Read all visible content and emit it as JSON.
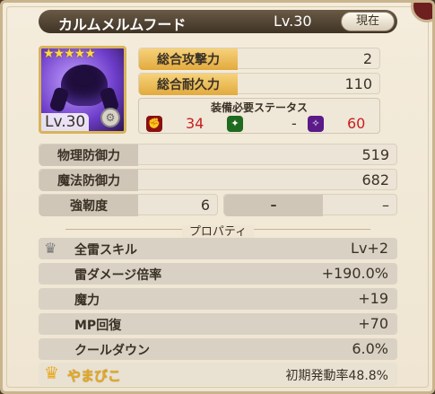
{
  "header": {
    "name": "カルムメルムフード",
    "level": "Lv.30",
    "current_button": "現在"
  },
  "portrait": {
    "level": "Lv.30",
    "stars": "★★★★★"
  },
  "stats": {
    "attack": {
      "label": "総合攻撃力",
      "value": "2"
    },
    "durability": {
      "label": "総合耐久力",
      "value": "110"
    }
  },
  "requirements": {
    "title": "装備必要ステータス",
    "items": [
      {
        "icon": "strength-icon",
        "value": "34",
        "color": "#c62020"
      },
      {
        "icon": "agility-icon",
        "value": "-",
        "color": "#2a8a2a"
      },
      {
        "icon": "magic-icon",
        "value": "60",
        "color": "#7a2aa8"
      }
    ]
  },
  "defense": {
    "physical": {
      "label": "物理防御力",
      "value": "519"
    },
    "magic": {
      "label": "魔法防御力",
      "value": "682"
    },
    "toughness": {
      "label": "強靭度",
      "value": "6",
      "extra1": "–",
      "extra2": "–"
    }
  },
  "properties_title": "プロパティ",
  "properties": [
    {
      "label": "全雷スキル",
      "value": "Lv+2",
      "icon": "silver-crown-icon"
    },
    {
      "label": "雷ダメージ倍率",
      "value": "+190.0%"
    },
    {
      "label": "魔力",
      "value": "+19"
    },
    {
      "label": "MP回復",
      "value": "+70"
    },
    {
      "label": "クールダウン",
      "value": "6.0%"
    }
  ],
  "special": {
    "name": "やまびこ",
    "rate": "初期発動率48.8%",
    "icon": "gold-crown-icon"
  }
}
